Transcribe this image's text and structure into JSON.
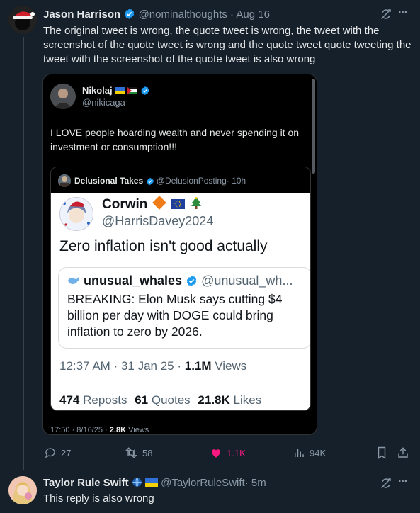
{
  "post": {
    "name": "Jason Harrison",
    "handle": "@nominalthoughts",
    "sep": "·",
    "date": "Aug 16",
    "text": "The original tweet is wrong, the quote tweet is wrong, the tweet with the screenshot of the quote tweet is wrong and the quote tweet quote tweeting the tweet with the screenshot of the quote tweet is also wrong",
    "more": "···"
  },
  "quote": {
    "name": "Nikolaj",
    "handle": "@nikicaga",
    "text": "I LOVE people hoarding wealth and never spending it on investment or consumption!!!",
    "footer": {
      "time": "17:50 · 8/16/25 ·",
      "views_count": "2.8K",
      "views_label": "Views"
    },
    "embedded": {
      "name": "Delusional Takes",
      "handle": "@DelusionPosting",
      "time": "· 10h",
      "tweet": {
        "name": "Corwin",
        "handle": "@HarrisDavey2024",
        "text": "Zero inflation isn't good actually",
        "quoted": {
          "name": "unusual_whales",
          "handle": "@unusual_wh...",
          "text": "BREAKING: Elon Musk says cutting $4 billion per day with DOGE could bring inflation to zero by 2026."
        },
        "timestamp": "12:37 AM · 31 Jan 25 ·",
        "views_count": "1.1M",
        "views_label": "Views",
        "reposts_count": "474",
        "reposts_label": "Reposts",
        "quotes_count": "61",
        "quotes_label": "Quotes",
        "likes_count": "21.8K",
        "likes_label": "Likes"
      }
    }
  },
  "actions": {
    "replies": "27",
    "reposts": "58",
    "likes": "1.1K",
    "views": "94K"
  },
  "reply": {
    "name": "Taylor Rule Swift",
    "handle": "@TaylorRuleSwift",
    "time": "· 5m",
    "text": "This reply is also wrong",
    "more": "···"
  },
  "colors": {
    "background": "#15202b",
    "verified": "#1d9bf0",
    "like": "#f91880",
    "muted": "#8b98a5"
  }
}
